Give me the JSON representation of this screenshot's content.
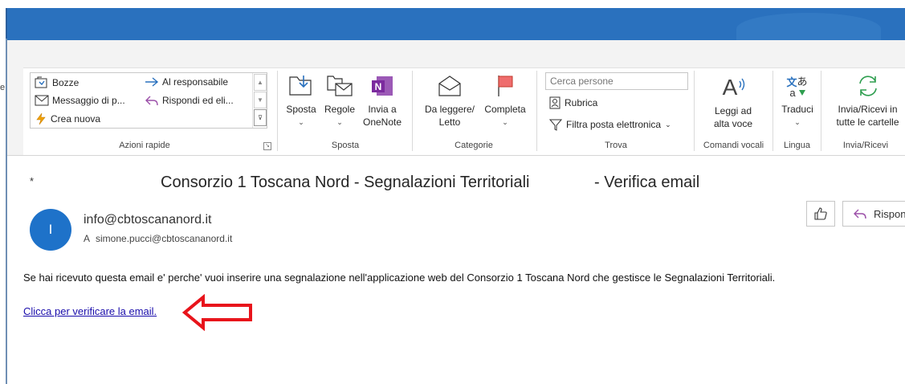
{
  "ribbon": {
    "quick_steps": {
      "items": [
        {
          "label": "Bozze",
          "icon": "draft-folder-icon"
        },
        {
          "label": "Messaggio di p...",
          "icon": "envelope-icon"
        },
        {
          "label": "Crea nuova",
          "icon": "lightning-icon"
        },
        {
          "label": "Al responsabile",
          "icon": "arrow-right-icon"
        },
        {
          "label": "Rispondi ed eli...",
          "icon": "reply-icon"
        }
      ],
      "group_label": "Azioni rapide"
    },
    "move": {
      "buttons": [
        {
          "label": "Sposta",
          "icon": "move-folder-icon"
        },
        {
          "label": "Regole",
          "icon": "rules-icon"
        },
        {
          "label_line1": "Invia a",
          "label_line2": "OneNote",
          "icon": "onenote-icon",
          "icon_letter": "N"
        }
      ],
      "group_label": "Sposta"
    },
    "tags": {
      "buttons": [
        {
          "label_line1": "Da leggere/",
          "label_line2": "Letto",
          "icon": "open-envelope-icon"
        },
        {
          "label": "Completa",
          "icon": "flag-icon"
        }
      ],
      "group_label": "Categorie"
    },
    "find": {
      "search_placeholder": "Cerca persone",
      "address_book": "Rubrica",
      "filter": "Filtra posta elettronica",
      "group_label": "Trova"
    },
    "speech": {
      "label_line1": "Leggi ad",
      "label_line2": "alta voce",
      "icon": "read-aloud-icon",
      "icon_letter": "A",
      "group_label": "Comandi vocali"
    },
    "language": {
      "label": "Traduci",
      "icon": "translate-icon",
      "group_label": "Lingua"
    },
    "send_receive": {
      "label_line1": "Invia/Ricevi in",
      "label_line2": "tutte le cartelle",
      "icon": "sync-icon",
      "group_label": "Invia/Ricevi"
    }
  },
  "left_stub": "e",
  "message": {
    "star": "*",
    "subject_part1": "Consorzio 1 Toscana Nord - Segnalazioni Territoriali",
    "subject_part2": "- Verifica email",
    "avatar_initial": "I",
    "sender": "info@cbtoscananord.it",
    "to_prefix": "A",
    "to": "simone.pucci@cbtoscananord.it",
    "reply_label": "Rispon",
    "body": "Se hai ricevuto questa email e' perche' vuoi inserire una segnalazione nell'applicazione web del Consorzio 1 Toscana Nord che gestisce le Segnalazioni Territoriali.",
    "link_text": "Clicca per verificare la email."
  },
  "colors": {
    "titlebar": "#2a71be",
    "link": "#1a0dab",
    "annotation_arrow": "#e8141b",
    "avatar": "#1e72c9"
  }
}
